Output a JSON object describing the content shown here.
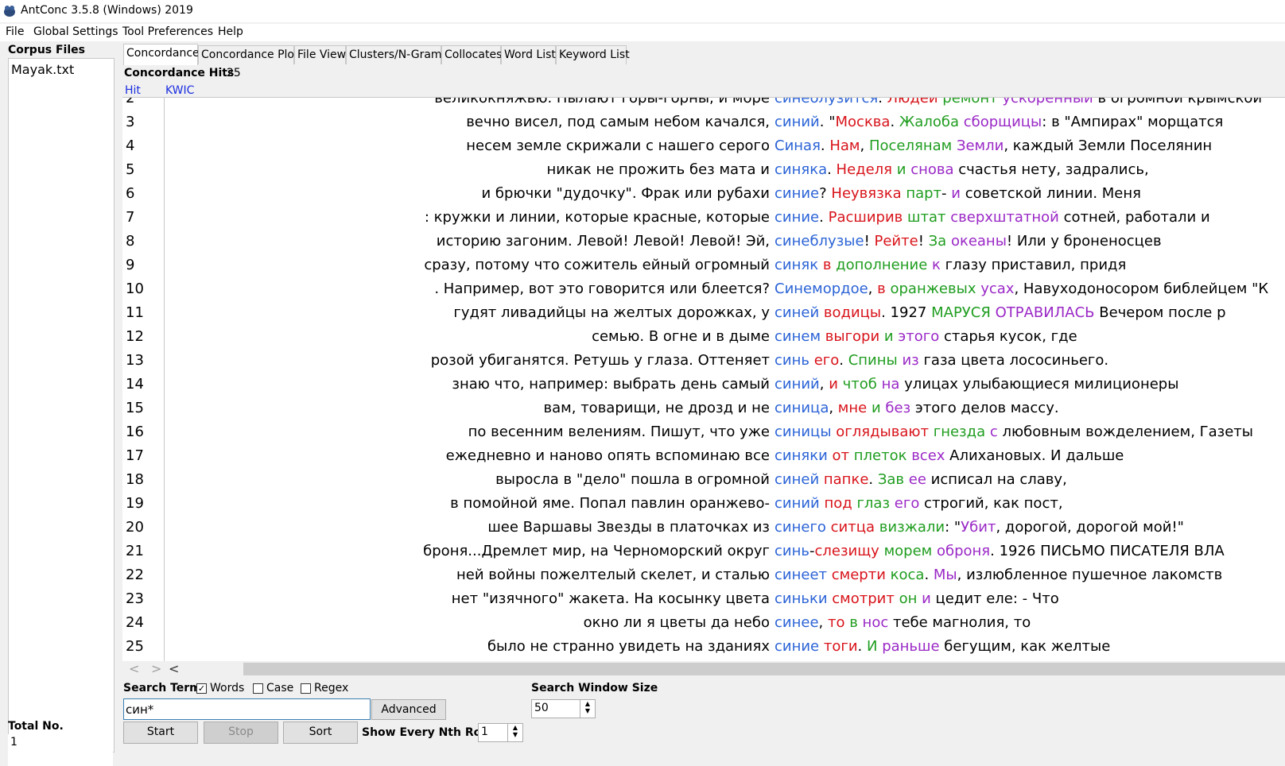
{
  "window": {
    "title": "AntConc 3.5.8 (Windows) 2019"
  },
  "menu": [
    "File",
    "Global Settings",
    "Tool Preferences",
    "Help"
  ],
  "corpus": {
    "header": "Corpus Files",
    "files": [
      "Mayak.txt"
    ],
    "total_label": "Total No.",
    "total_value": "1"
  },
  "tabs": [
    "Concordance",
    "Concordance Plot",
    "File View",
    "Clusters/N-Grams",
    "Collocates",
    "Word List",
    "Keyword List"
  ],
  "hits": {
    "label": "Concordance Hits",
    "value": "25"
  },
  "columns": {
    "hit": "Hit",
    "kwic": "KWIC"
  },
  "colors": {
    "blue": "#2b63d6",
    "red": "#d8141b",
    "green": "#1f9d1f",
    "purple": "#9a28c6",
    "header_blue": "#1a2ee0"
  },
  "rows": [
    {
      "n": "2",
      "left": "великокняжью. Пылают горы-горны, и море",
      "kw": "синеблузится",
      "right": [
        [
          ". ",
          ""
        ],
        [
          "Людей",
          "r"
        ],
        [
          " ",
          ""
        ],
        [
          "ремонт",
          "g"
        ],
        [
          " ",
          ""
        ],
        [
          "ускоренный",
          "p"
        ],
        [
          " в огромной  крымской",
          ""
        ]
      ]
    },
    {
      "n": "3",
      "left": "вечно висел, под самым небом качался,",
      "kw": "синий",
      "right": [
        [
          ".  \"",
          ""
        ],
        [
          "Москва",
          "r"
        ],
        [
          ". ",
          ""
        ],
        [
          "Жалоба",
          "g"
        ],
        [
          " ",
          ""
        ],
        [
          "сборщицы",
          "p"
        ],
        [
          ": в \"Ампирах\" морщатся",
          ""
        ]
      ]
    },
    {
      "n": "4",
      "left": "несем земле скрижали с нашего серого",
      "kw": "Синая",
      "right": [
        [
          ".  ",
          ""
        ],
        [
          "Нам",
          "r"
        ],
        [
          ", ",
          ""
        ],
        [
          "Поселянам",
          "g"
        ],
        [
          " ",
          ""
        ],
        [
          "Земли",
          "p"
        ],
        [
          ", каждый Земли Поселянин",
          ""
        ]
      ]
    },
    {
      "n": "5",
      "left": "никак не прожить  без мата и",
      "kw": "синяка",
      "right": [
        [
          ".  ",
          ""
        ],
        [
          "Неделя",
          "r"
        ],
        [
          "  ",
          ""
        ],
        [
          "и",
          "g"
        ],
        [
          " ",
          ""
        ],
        [
          "снова",
          "p"
        ],
        [
          " счастья нету, задрались,",
          ""
        ]
      ]
    },
    {
      "n": "6",
      "left": "и брючки \"дудочку\". Фрак  или рубахи",
      "kw": "синие",
      "right": [
        [
          "? ",
          ""
        ],
        [
          "Неувязка",
          "r"
        ],
        [
          " ",
          ""
        ],
        [
          "парт",
          "g"
        ],
        [
          "- ",
          ""
        ],
        [
          "и",
          "p"
        ],
        [
          " советской линии. Меня",
          ""
        ]
      ]
    },
    {
      "n": "7",
      "left": ": кружки и линии, которые красные, которые",
      "kw": "синие",
      "right": [
        [
          ". ",
          ""
        ],
        [
          "Расширив",
          "r"
        ],
        [
          " ",
          ""
        ],
        [
          "штат",
          "g"
        ],
        [
          " ",
          ""
        ],
        [
          "сверхштатной",
          "p"
        ],
        [
          " сотней, работали и",
          ""
        ]
      ]
    },
    {
      "n": "8",
      "left": "историю загоним. Левой! Левой! Левой!  Эй,",
      "kw": "синеблузые",
      "right": [
        [
          "! ",
          ""
        ],
        [
          "Рейте",
          "r"
        ],
        [
          "! ",
          ""
        ],
        [
          "За",
          "g"
        ],
        [
          " ",
          ""
        ],
        [
          "океаны",
          "p"
        ],
        [
          "! Или у броненосцев",
          ""
        ]
      ]
    },
    {
      "n": "9",
      "left": "сразу, потому что сожитель ейный огромный",
      "kw": "синяк",
      "right": [
        [
          "  ",
          ""
        ],
        [
          "в",
          "r"
        ],
        [
          " ",
          ""
        ],
        [
          "дополнение",
          "g"
        ],
        [
          " ",
          ""
        ],
        [
          "к",
          "p"
        ],
        [
          " глазу приставил,  придя",
          ""
        ]
      ]
    },
    {
      "n": "10",
      "left": ". Например,  вот это  говорится или блеется?",
      "kw": "Синемордое",
      "right": [
        [
          ",  ",
          ""
        ],
        [
          "в",
          "r"
        ],
        [
          " ",
          ""
        ],
        [
          "оранжевых",
          "g"
        ],
        [
          " ",
          ""
        ],
        [
          "усах",
          "p"
        ],
        [
          ", Навуходоносором  библейцем \"К",
          ""
        ]
      ]
    },
    {
      "n": "11",
      "left": "гудят ливадийцы на желтых дорожках,  у",
      "kw": "синей",
      "right": [
        [
          " ",
          ""
        ],
        [
          "водицы",
          "r"
        ],
        [
          ".  1927  ",
          ""
        ],
        [
          "МАРУСЯ",
          "g"
        ],
        [
          " ",
          ""
        ],
        [
          "ОТРАВИЛАСЬ",
          "p"
        ],
        [
          "  Вечером после р",
          ""
        ]
      ]
    },
    {
      "n": "12",
      "left": "семью.  В огне  и в дыме",
      "kw": "синем",
      "right": [
        [
          " ",
          ""
        ],
        [
          "выгори",
          "r"
        ],
        [
          "  ",
          ""
        ],
        [
          "и",
          "g"
        ],
        [
          " ",
          ""
        ],
        [
          "этого",
          "p"
        ],
        [
          " старья кусок, где",
          ""
        ]
      ]
    },
    {
      "n": "13",
      "left": "розой убиганятся. Ретушь  у глаза. Оттеняет",
      "kw": "синь",
      "right": [
        [
          " ",
          ""
        ],
        [
          "его",
          "r"
        ],
        [
          ". ",
          ""
        ],
        [
          "Спины",
          "g"
        ],
        [
          "  ",
          ""
        ],
        [
          "из",
          "p"
        ],
        [
          " газа цвета лососиньего.",
          ""
        ]
      ]
    },
    {
      "n": "14",
      "left": "знаю что,  например:  выбрать день  самый",
      "kw": "синий",
      "right": [
        [
          ", ",
          ""
        ],
        [
          "и",
          "r"
        ],
        [
          " ",
          ""
        ],
        [
          "чтоб",
          "g"
        ],
        [
          " ",
          ""
        ],
        [
          "на",
          "p"
        ],
        [
          " улицах  улыбающиеся милиционеры",
          ""
        ]
      ]
    },
    {
      "n": "15",
      "left": "вам, товарищи,  не дрозд  и не",
      "kw": "синица",
      "right": [
        [
          ", ",
          ""
        ],
        [
          "мне",
          "r"
        ],
        [
          "  ",
          ""
        ],
        [
          "и",
          "g"
        ],
        [
          " ",
          ""
        ],
        [
          "без",
          "p"
        ],
        [
          " этого  делов массу.",
          ""
        ]
      ]
    },
    {
      "n": "16",
      "left": "по весенним велениям. Пишут,  что уже",
      "kw": "синицы",
      "right": [
        [
          " ",
          ""
        ],
        [
          "оглядывают",
          "r"
        ],
        [
          " ",
          ""
        ],
        [
          "гнезда",
          "g"
        ],
        [
          "  ",
          ""
        ],
        [
          "с",
          "p"
        ],
        [
          " любовным вожделением, Газеты",
          ""
        ]
      ]
    },
    {
      "n": "17",
      "left": "ежедневно  и наново опять вспоминаю  все",
      "kw": "синяки",
      "right": [
        [
          " ",
          ""
        ],
        [
          "от",
          "r"
        ],
        [
          " ",
          ""
        ],
        [
          "плеток",
          "g"
        ],
        [
          "  ",
          ""
        ],
        [
          "всех",
          "p"
        ],
        [
          " Алихановых. И дальше",
          ""
        ]
      ]
    },
    {
      "n": "18",
      "left": "выросла в \"дело\" пошла в огромной",
      "kw": "синей",
      "right": [
        [
          " ",
          ""
        ],
        [
          "папке",
          "r"
        ],
        [
          ". ",
          ""
        ],
        [
          "Зав",
          "g"
        ],
        [
          " ",
          ""
        ],
        [
          "ее",
          "p"
        ],
        [
          " исписал на славу,",
          ""
        ]
      ]
    },
    {
      "n": "19",
      "left": "в помойной яме.  Попал павлин оранжево-",
      "kw": "синий",
      "right": [
        [
          " ",
          ""
        ],
        [
          "под",
          "r"
        ],
        [
          " ",
          ""
        ],
        [
          "глаз",
          "g"
        ],
        [
          " ",
          ""
        ],
        [
          "его",
          "p"
        ],
        [
          " строгий, как пост,",
          ""
        ]
      ]
    },
    {
      "n": "20",
      "left": "шее Варшавы Звезды в платочках из",
      "kw": "синего",
      "right": [
        [
          " ",
          ""
        ],
        [
          "ситца",
          "r"
        ],
        [
          " ",
          ""
        ],
        [
          "визжали",
          "g"
        ],
        [
          ": \"",
          ""
        ],
        [
          "Убит",
          "p"
        ],
        [
          ", дорогой, дорогой мой!\"",
          ""
        ]
      ]
    },
    {
      "n": "21",
      "left": "броня...Дремлет мир,  на Черноморский округ",
      "kw": "синь",
      "right": [
        [
          "-",
          ""
        ],
        [
          "слезищу",
          "r"
        ],
        [
          "  ",
          ""
        ],
        [
          "морем",
          "g"
        ],
        [
          " ",
          ""
        ],
        [
          "оброня",
          "p"
        ],
        [
          ".  1926  ПИСЬМО ПИСАТЕЛЯ ВЛА",
          ""
        ]
      ]
    },
    {
      "n": "22",
      "left": "ней  войны  пожелтелый скелет, и сталью",
      "kw": "синеет",
      "right": [
        [
          "  ",
          ""
        ],
        [
          "смерти",
          "r"
        ],
        [
          " ",
          ""
        ],
        [
          "коса",
          "g"
        ],
        [
          ". ",
          ""
        ],
        [
          "Мы",
          "p"
        ],
        [
          ",  излюбленное  пушечное лакомств",
          ""
        ]
      ]
    },
    {
      "n": "23",
      "left": "нет  \"изячного\" жакета. На косынку  цвета",
      "kw": "синьки",
      "right": [
        [
          " ",
          ""
        ],
        [
          "смотрит",
          "r"
        ],
        [
          " ",
          ""
        ],
        [
          "он",
          "g"
        ],
        [
          "  ",
          ""
        ],
        [
          "и",
          "p"
        ],
        [
          " цедит еле: - Что",
          ""
        ]
      ]
    },
    {
      "n": "24",
      "left": "окно ли я цветы  да небо",
      "kw": "синее",
      "right": [
        [
          ", ",
          ""
        ],
        [
          "то",
          "r"
        ],
        [
          " ",
          ""
        ],
        [
          "в",
          "g"
        ],
        [
          " ",
          ""
        ],
        [
          "нос",
          "p"
        ],
        [
          " тебе магнолия, то",
          ""
        ]
      ]
    },
    {
      "n": "25",
      "left": "было не странно увидеть на зданиях",
      "kw": "синие",
      "right": [
        [
          " ",
          ""
        ],
        [
          "тоги",
          "r"
        ],
        [
          ". ",
          ""
        ],
        [
          "И",
          "g"
        ],
        [
          " ",
          ""
        ],
        [
          "раньше",
          "p"
        ],
        [
          " бегущим, как желтые",
          ""
        ]
      ]
    }
  ],
  "search": {
    "label": "Search Term",
    "words_label": "Words",
    "words_checked": true,
    "case_label": "Case",
    "case_checked": false,
    "regex_label": "Regex",
    "regex_checked": false,
    "value": "син*",
    "advanced_label": "Advanced",
    "window_size_label": "Search Window Size",
    "window_size_value": "50"
  },
  "buttons": {
    "start": "Start",
    "stop": "Stop",
    "sort": "Sort"
  },
  "nth_row": {
    "label": "Show Every Nth Row",
    "value": "1"
  }
}
